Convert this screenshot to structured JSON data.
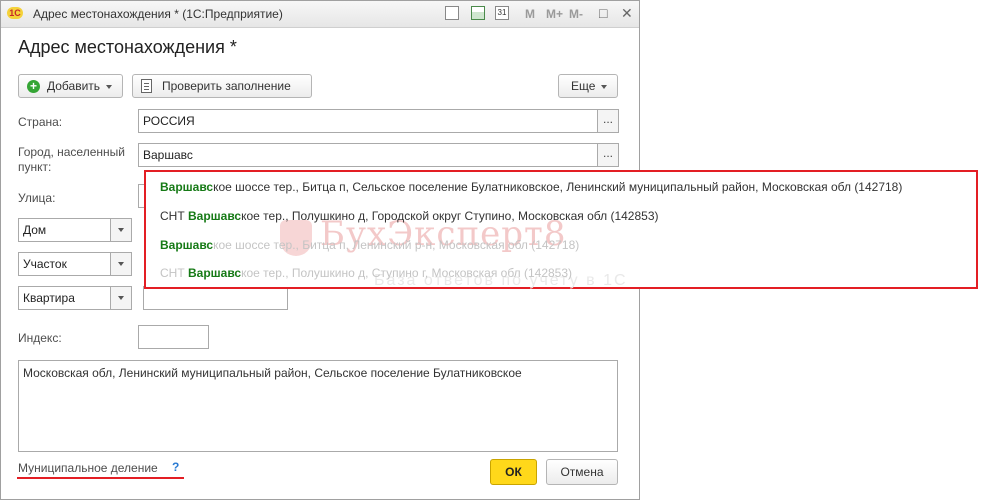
{
  "window": {
    "logo": "1С",
    "title": "Адрес местонахождения * (1С:Предприятие)",
    "title_buttons": [
      "M",
      "M+",
      "M-"
    ]
  },
  "form": {
    "title": "Адрес местонахождения *",
    "toolbar": {
      "add_label": "Добавить",
      "check_label": "Проверить заполнение",
      "more_label": "Еще"
    },
    "country": {
      "label": "Страна:",
      "value": "РОССИЯ",
      "pick": "..."
    },
    "city": {
      "label": "Город, населенный пункт:",
      "value": "Варшавс",
      "pick": "..."
    },
    "street": {
      "label": "Улица:"
    },
    "house": {
      "type": "Дом"
    },
    "plot": {
      "type": "Участок"
    },
    "apartment": {
      "type": "Квартира"
    },
    "index": {
      "label": "Индекс:"
    },
    "address_text": "Московская обл, Ленинский муниципальный район, Сельское поселение Булатниковское",
    "municipal_link": "Муниципальное деление",
    "help": "?",
    "ok_label": "ОК",
    "cancel_label": "Отмена"
  },
  "suggestions": [
    {
      "match": "Варшавс",
      "prefix": "",
      "rest": "кое шоссе тер., Битца п, Сельское поселение Булатниковское, Ленинский муниципальный район, Московская обл (142718)",
      "faded": false
    },
    {
      "match": "Варшавс",
      "prefix": "СНТ ",
      "rest": "кое тер., Полушкино д, Городской округ Ступино, Московская обл (142853)",
      "faded": false
    },
    {
      "match": "Варшавс",
      "prefix": "",
      "rest": "кое шоссе тер., Битца п, Ленинский р-н, Московская обл (142718)",
      "faded": true
    },
    {
      "match": "Варшавс",
      "prefix": "СНТ ",
      "rest": "кое тер., Полушкино д, Ступино г, Московская обл (142853)",
      "faded": true
    }
  ],
  "watermark": {
    "title": "БухЭксперт8",
    "subtitle": "База ответов по учету в 1С"
  },
  "colors": {
    "highlight_red": "#e31e24",
    "match_green": "#167a16",
    "ok_yellow": "#ffd81a",
    "link_blue": "#2a7bd3"
  }
}
